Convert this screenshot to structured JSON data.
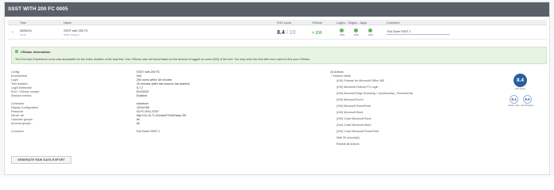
{
  "header": {
    "title": "SSST WITH 200 FC 0005"
  },
  "columns": [
    "Time",
    "Name",
    "EUX score",
    "VSImax",
    "Logins - Engine - Apps",
    "Comment"
  ],
  "row": {
    "date": "26/06/24",
    "time": "13:40",
    "name": "SSST with 200 FC",
    "name_sub": "SSST: finished",
    "score": "8.4",
    "score_denominator": "/ 10",
    "vsimax": "> 200",
    "status_labels": [
      "100%",
      "100%",
      "100%"
    ],
    "comment": "Full Clone SSST 1"
  },
  "vsimax_info": {
    "title": "VSImax information",
    "body": "The End User Experience score was acceptable for the entire duration of the load test. Your VSImax was not found based on the amount of logged on users (200) of the test. You may rerun the test with more users to find your VSImax."
  },
  "details": [
    {
      "key": "Config",
      "value": "SSST with 200 FC"
    },
    {
      "key": "Environment",
      "value": "N/A"
    },
    {
      "key": "Login",
      "value": "200 users within 48 minutes"
    },
    {
      "key": "Test duration",
      "value": "15 minutes (after last session has started)"
    },
    {
      "key": "Login Enterprise",
      "value": "5.7.2"
    },
    {
      "key": "EUX / VSImax version",
      "value": "EUX2023"
    },
    {
      "key": "Session metrics",
      "value": "Enabled"
    },
    {
      "key": "Connector",
      "value": "storefront"
    },
    {
      "key": "Display Configuration",
      "value": "1024x768"
    },
    {
      "key": "Resource",
      "value": "03-FC-W11-STAT"
    },
    {
      "key": "Server Url",
      "value": "http://10.10.71.42/citrix/FSeWStack-SN"
    },
    {
      "key": "Launcher groups",
      "value": "All"
    },
    {
      "key": "Account groups",
      "value": "All"
    },
    {
      "key": "Comment",
      "value": "Full Clone SSST 1"
    }
  ],
  "actions": {
    "count": "16 Actions",
    "items": [
      "Session starts",
      "(KW) Prepare for Microsoft Office 365",
      "(KW) Microsoft Outlook FS Login",
      "(KW) Microsoft Edge Browsing + (multimedia) _PersonalCity",
      "(KW) Microsoft Excel",
      "(KW) Microsoft PowerPoint",
      "(KW) Microsoft Word",
      "(KW) Close Microsoft Excel",
      "(KW) Close Microsoft Word",
      "(KW) Close Microsoft PowerPoint",
      "Wait 30 second(s)",
      "Repeat all actions"
    ]
  },
  "scores": {
    "main": "8.4",
    "main_label": "EUX Score",
    "steady": "8.4",
    "steady_label": "Steady state",
    "baseline": "8.6",
    "baseline_label": "EUX Baseline"
  },
  "buttons": {
    "generate": "GENERATE RAW DATA EXPORT"
  },
  "colors": {
    "header": "#5b5f68",
    "good": "#5cb85c",
    "score_badge": "#2a5f9e",
    "info_bg": "#e8f3e4"
  }
}
